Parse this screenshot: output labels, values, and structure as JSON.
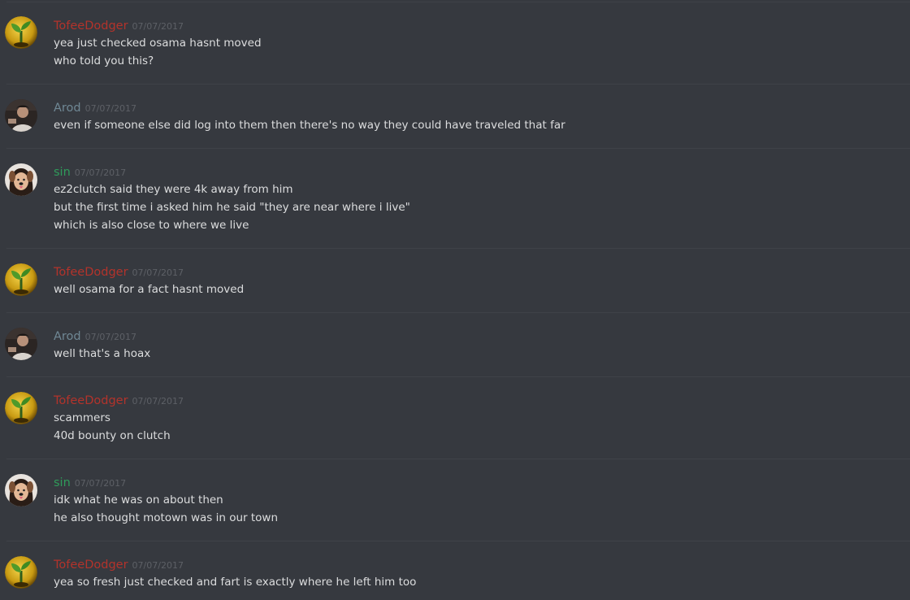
{
  "colors": {
    "background": "#36393f",
    "divider": "#3f4248",
    "text": "#dcddde",
    "timestamp": "#5d6066",
    "TofeeDodger": "#b3332b",
    "Arod": "#6f8794",
    "sin": "#2f9b5a"
  },
  "messages": [
    {
      "author": "TofeeDodger",
      "timestamp": "07/07/2017",
      "avatar_icon": "sprout-icon",
      "lines": [
        "yea just checked osama hasnt moved",
        "who told you this?"
      ]
    },
    {
      "author": "Arod",
      "timestamp": "07/07/2017",
      "avatar_icon": "person-photo-icon",
      "lines": [
        "even if someone else did log into them then there's no way they could have traveled that far"
      ]
    },
    {
      "author": "sin",
      "timestamp": "07/07/2017",
      "avatar_icon": "dog-filter-face-icon",
      "lines": [
        "ez2clutch said they were 4k away from him",
        "but the first time i asked him he said \"they are near where i live\"",
        "which is also close to where we live"
      ]
    },
    {
      "author": "TofeeDodger",
      "timestamp": "07/07/2017",
      "avatar_icon": "sprout-icon",
      "lines": [
        "well osama for a fact hasnt moved"
      ]
    },
    {
      "author": "Arod",
      "timestamp": "07/07/2017",
      "avatar_icon": "person-photo-icon",
      "lines": [
        "well that's a hoax"
      ]
    },
    {
      "author": "TofeeDodger",
      "timestamp": "07/07/2017",
      "avatar_icon": "sprout-icon",
      "lines": [
        "scammers",
        "40d bounty on clutch"
      ]
    },
    {
      "author": "sin",
      "timestamp": "07/07/2017",
      "avatar_icon": "dog-filter-face-icon",
      "lines": [
        "idk what he was on about then",
        "he also thought motown was in our town"
      ]
    },
    {
      "author": "TofeeDodger",
      "timestamp": "07/07/2017",
      "avatar_icon": "sprout-icon",
      "lines": [
        "yea so fresh just checked and fart is exactly where he left him too"
      ]
    }
  ]
}
